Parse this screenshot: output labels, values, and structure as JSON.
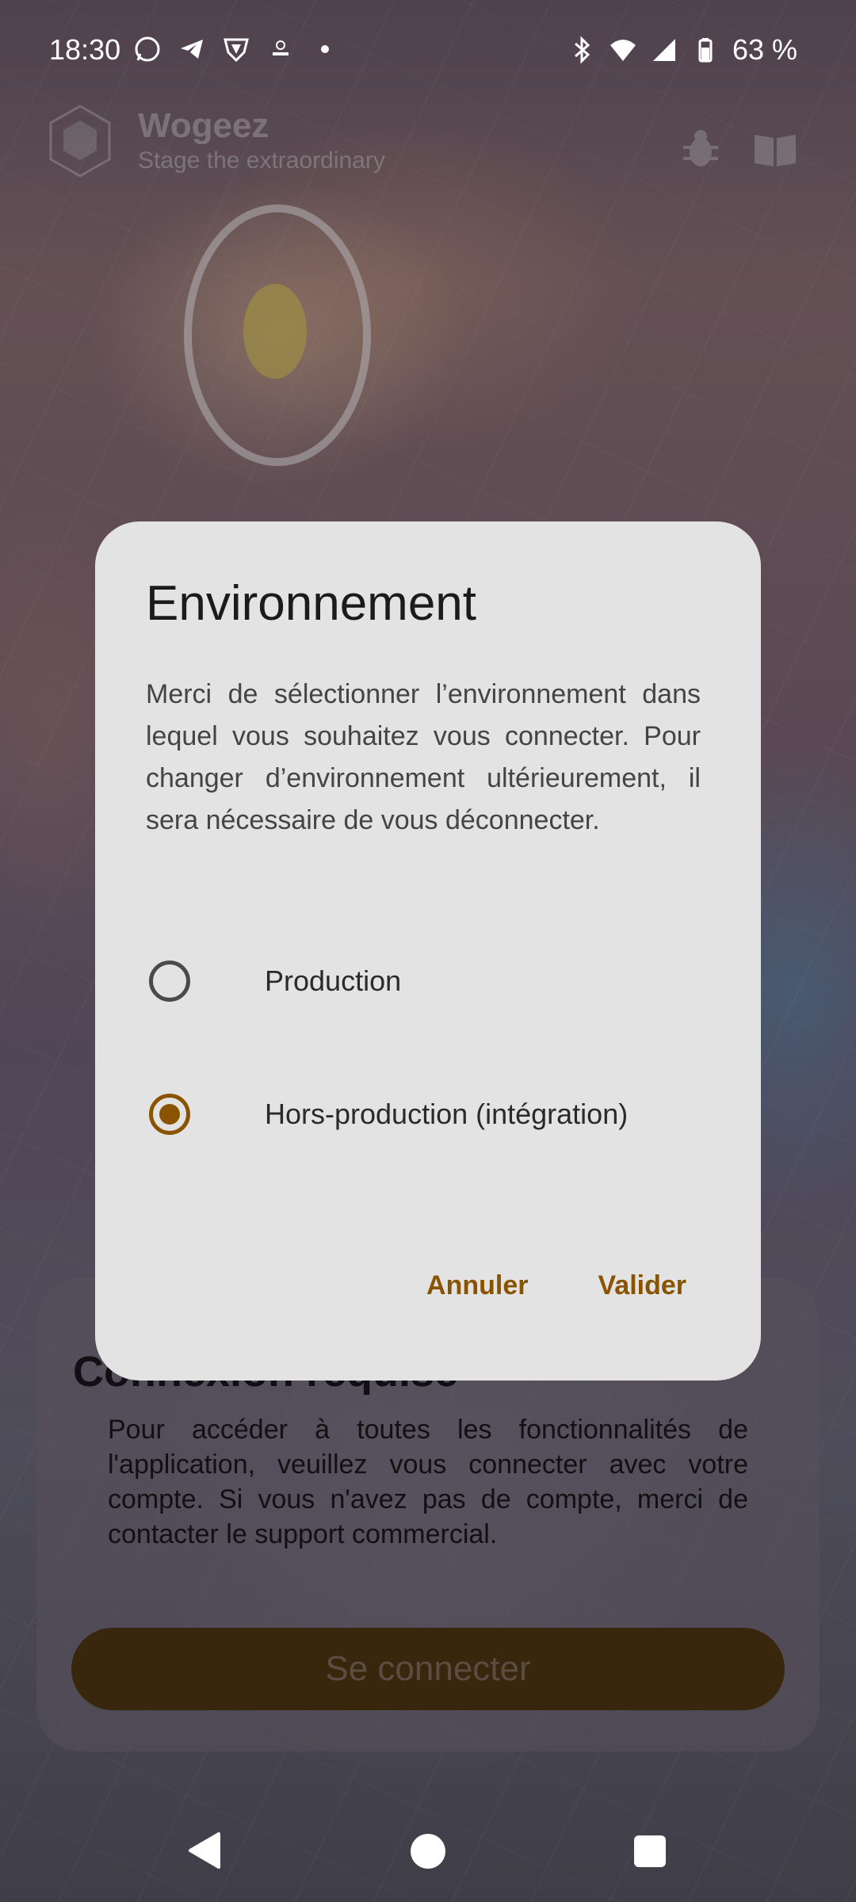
{
  "status_bar": {
    "time": "18:30",
    "left_icons": [
      "whatsapp-icon",
      "telegram-icon",
      "vpn-shield-icon",
      "notification-icon",
      "dot-icon"
    ],
    "right_icons": [
      "bluetooth-icon",
      "wifi-icon",
      "signal-icon",
      "battery-icon"
    ],
    "battery": "63 %"
  },
  "app_header": {
    "title": "Wogeez",
    "subtitle": "Stage the extraordinary",
    "icons": [
      "bug-icon",
      "book-icon"
    ]
  },
  "login_card": {
    "title": "Connexion requise",
    "text": "Pour accéder à toutes les fonctionnalités de l'application, veuillez vous connecter avec votre compte. Si vous n'avez pas de compte, merci de contacter le support commercial.",
    "button_label": "Se connecter"
  },
  "dialog": {
    "title": "Environnement",
    "text": "Merci de sélectionner l’environnement dans lequel vous souhaitez vous connecter. Pour changer d’environnement ultérieurement, il sera nécessaire de vous déconnecter.",
    "options": [
      {
        "label": "Production",
        "selected": false
      },
      {
        "label": "Hors-production (intégration)",
        "selected": true
      }
    ],
    "cancel_label": "Annuler",
    "confirm_label": "Valider",
    "accent_color": "#8a5300"
  },
  "nav_bar": {
    "buttons": [
      "back-icon",
      "home-icon",
      "recents-icon"
    ]
  }
}
